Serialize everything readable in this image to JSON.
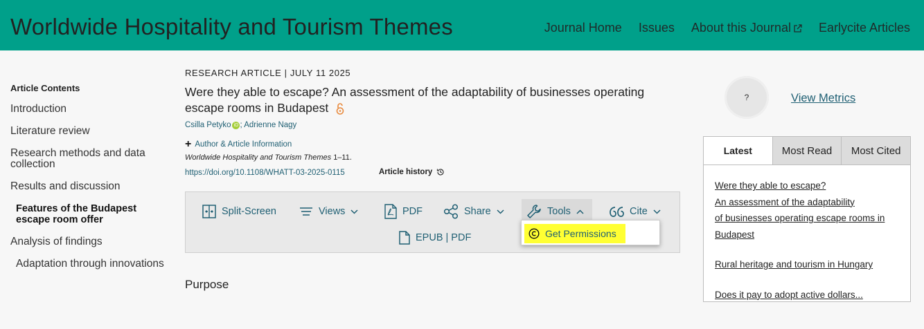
{
  "header": {
    "brand": "Worldwide Hospitality and Tourism Themes",
    "nav": [
      "Journal Home",
      "Issues",
      "About this Journal",
      "Earlycite Articles"
    ]
  },
  "toc": {
    "title": "Article Contents",
    "items": [
      {
        "label": "Introduction"
      },
      {
        "label": "Literature review"
      },
      {
        "label": "Research methods and data collection"
      },
      {
        "label": "Results and discussion"
      },
      {
        "label": "Features of the Budapest escape room offer"
      },
      {
        "label": "Analysis of findings"
      },
      {
        "label": "Adaptation through innovations"
      }
    ]
  },
  "article": {
    "type": "RESEARCH ARTICLE",
    "separator": "|",
    "date": "JULY 11 2025",
    "title": "Were they able to escape? An assessment of the adaptability of businesses operating escape rooms in Budapest",
    "author1": "Csilla Petyko",
    "author_sep": ";",
    "author2": "Adrienne Nagy",
    "author_info": "Author & Article Information",
    "journal": "Worldwide Hospitality and Tourism Themes",
    "pages": "1–11.",
    "doi": "https://doi.org/10.1108/WHATT-03-2025-0115",
    "history": "Article history",
    "section": "Purpose"
  },
  "toolbar": {
    "split": "Split-Screen",
    "views": "Views",
    "pdf": "PDF",
    "share": "Share",
    "tools": "Tools",
    "cite": "Cite",
    "epub": "EPUB | PDF",
    "permissions": "Get Permissions"
  },
  "metrics": {
    "badge": "?",
    "link": "View Metrics"
  },
  "panel": {
    "tabs": [
      "Latest",
      "Most Read",
      "Most Cited"
    ],
    "item1_lines": [
      "Were they able to escape?",
      "An assessment of the adaptability",
      "of businesses operating escape rooms in",
      "Budapest"
    ],
    "item2": "Rural heritage and tourism in Hungary",
    "item3": "Does it pay to adopt active dollars..."
  },
  "colors": {
    "header_bg": "#00a08a",
    "link": "#1f5f73",
    "highlight": "#ffff33",
    "orcid": "#a6ce39",
    "open_access": "#e8893c"
  }
}
